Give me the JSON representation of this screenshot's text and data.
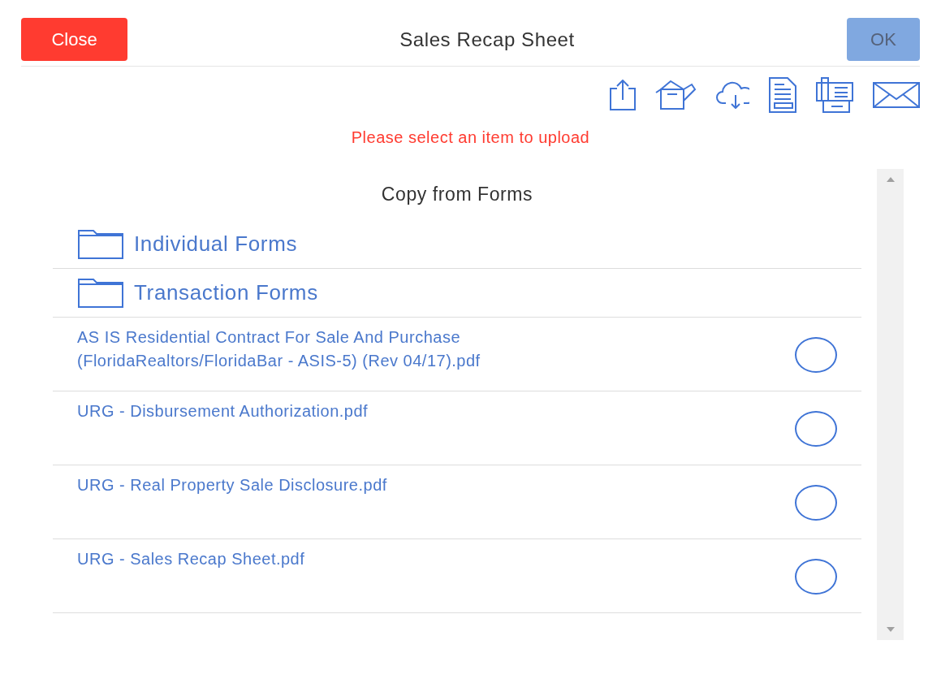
{
  "header": {
    "close_label": "Close",
    "title": "Sales Recap Sheet",
    "ok": {
      "label": "OK",
      "disabled": true
    }
  },
  "toolbar": [
    {
      "kind": "share"
    },
    {
      "kind": "box"
    },
    {
      "kind": "cloud"
    },
    {
      "kind": "document"
    },
    {
      "kind": "fax"
    },
    {
      "kind": "mail"
    }
  ],
  "message": "Please select an item to upload",
  "panel": {
    "title": "Copy from Forms",
    "folders": [
      {
        "label": "Individual Forms"
      },
      {
        "label": "Transaction Forms"
      }
    ],
    "files": [
      {
        "name": "AS IS Residential Contract For Sale And Purchase (FloridaRealtors/FloridaBar - ASIS-5) (Rev 04/17).pdf",
        "selected": false
      },
      {
        "name": "URG - Disbursement Authorization.pdf",
        "selected": false
      },
      {
        "name": "URG - Real Property Sale Disclosure.pdf",
        "selected": false
      },
      {
        "name": "URG - Sales Recap Sheet.pdf",
        "selected": false
      }
    ]
  }
}
